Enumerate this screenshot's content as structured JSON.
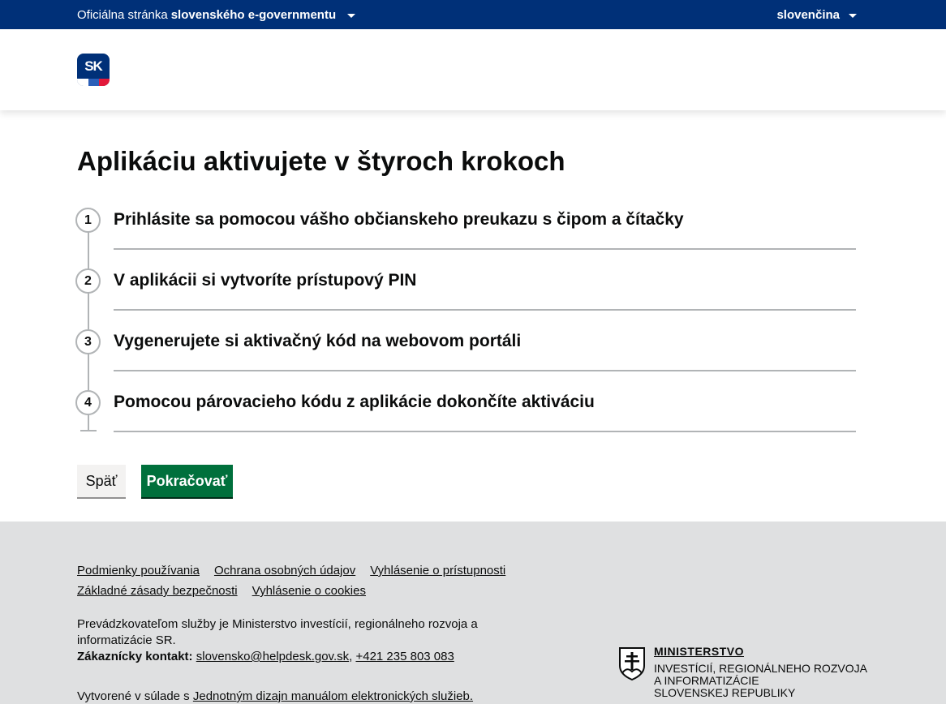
{
  "topbar": {
    "official_prefix": "Oficiálna stránka",
    "official_bold": "slovenského e-governmentu",
    "language": "slovenčina"
  },
  "header": {
    "logo_text": "SK"
  },
  "main": {
    "title": "Aplikáciu aktivujete v štyroch krokoch",
    "steps": [
      {
        "number": "1",
        "label": "Prihlásite sa pomocou vášho občianskeho preukazu s čipom a čítačky"
      },
      {
        "number": "2",
        "label": "V aplikácii si vytvoríte prístupový PIN"
      },
      {
        "number": "3",
        "label": "Vygenerujete si aktivačný kód na webovom portáli"
      },
      {
        "number": "4",
        "label": "Pomocou párovacieho kódu z aplikácie dokončíte aktiváciu"
      }
    ],
    "back_label": "Späť",
    "continue_label": "Pokračovať"
  },
  "footer": {
    "links_row1": [
      "Podmienky používania",
      "Ochrana osobných údajov",
      "Vyhlásenie o prístupnosti"
    ],
    "links_row2": [
      "Základné zásady bezpečnosti",
      "Vyhlásenie o cookies"
    ],
    "operator_text": "Prevádzkovateľom služby je Ministerstvo investícií, regionálneho rozvoja a informatizácie SR.",
    "contact_label": "Zákaznícky kontakt:",
    "contact_email": "slovensko@helpdesk.gov.sk",
    "contact_separator": ",",
    "contact_phone": "+421 235 803 083",
    "made_prefix": "Vytvorené v súlade s",
    "made_link": "Jednotným dizajn manuálom elektronických služieb.",
    "ministry_line1": "MINISTERSTVO",
    "ministry_line2": "INVESTÍCIÍ, REGIONÁLNEHO ROZVOJA",
    "ministry_line3": "A INFORMATIZÁCIE",
    "ministry_line4": "SLOVENSKEJ REPUBLIKY"
  },
  "colors": {
    "topbar": "#003078",
    "primary_button": "#00703c",
    "footer_bg": "#dfe0e1"
  }
}
